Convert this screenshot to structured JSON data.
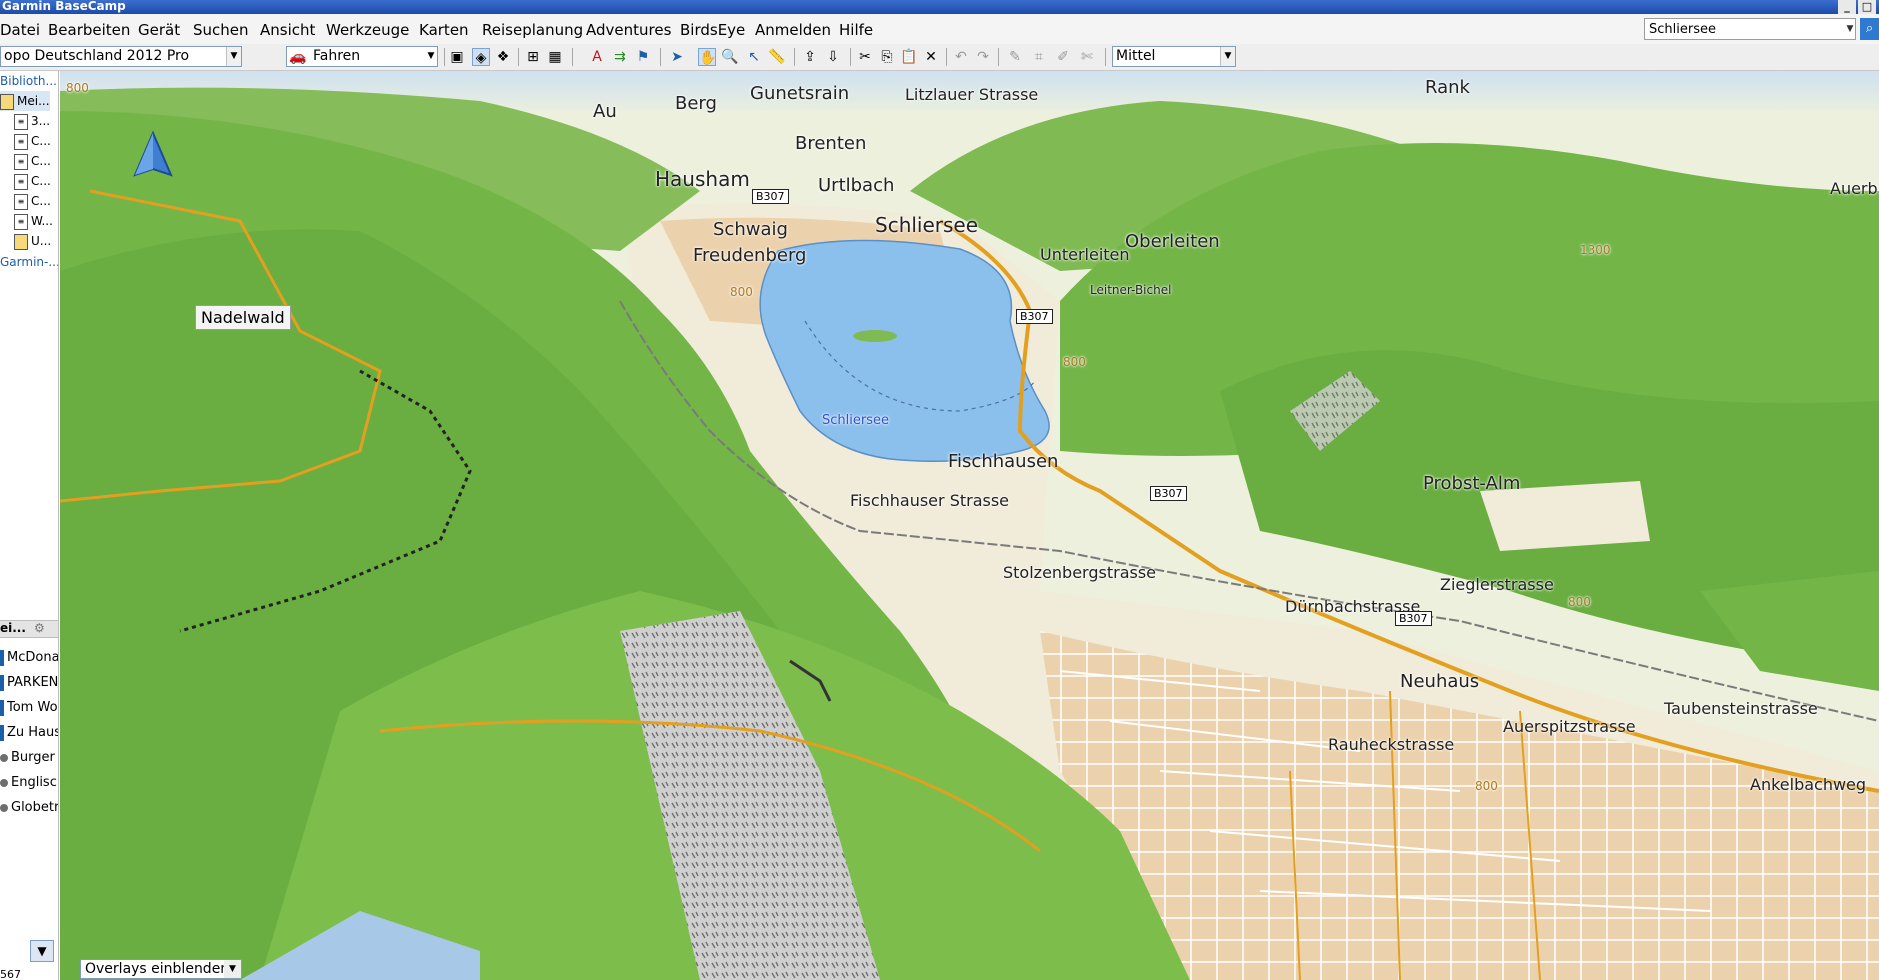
{
  "window": {
    "title": "Garmin BaseCamp"
  },
  "menu": [
    "Datei",
    "Bearbeiten",
    "Gerät",
    "Suchen",
    "Ansicht",
    "Werkzeuge",
    "Karten",
    "Reiseplanung",
    "Adventures",
    "BirdsEye",
    "Anmelden",
    "Hilfe"
  ],
  "search": {
    "value": "Schliersee"
  },
  "toolbar": {
    "map_product": "opo Deutschland 2012 Pro",
    "profile": "Fahren",
    "detail": "Mittel"
  },
  "library": {
    "header": "Biblioth...",
    "items": [
      "Mei...",
      "3...",
      "C...",
      "C...",
      "C...",
      "C...",
      "W...",
      "U...",
      "Garmin-..."
    ]
  },
  "list_panel": {
    "header": "ei...",
    "items": [
      "McDona",
      "PARKEN",
      "Tom Wo",
      "Zu Haus",
      "Burger K",
      "Englisch",
      "Globetro"
    ]
  },
  "status_fragment": "567",
  "map": {
    "places": [
      "Rank",
      "Au",
      "Berg",
      "Gunetsrain",
      "Litzlauer Strasse",
      "Brenten",
      "Hausham",
      "Urtlbach",
      "Schwaig",
      "Schliersee",
      "Freudenberg",
      "Unterleiten",
      "Oberleiten",
      "Leitner-Bichel",
      "Fischhausen",
      "Fischhauser Strasse",
      "Probst-Alm",
      "Stolzenbergstrasse",
      "Zieglerstrasse",
      "Dürnbachstrasse",
      "Neuhaus",
      "Taubensteinstrasse",
      "Auerspitzstrasse",
      "Rauheckstrasse",
      "Ankelbachweg",
      "Auerb"
    ],
    "lake_label": "Schliersee",
    "roads": [
      "B307",
      "B307",
      "B307",
      "B307"
    ],
    "contours": [
      "800",
      "800",
      "800",
      "1300",
      "800",
      "800"
    ],
    "tooltip": "Nadelwald",
    "overlays_select": "Overlays einblenden"
  },
  "colors": {
    "forest": "#74b548",
    "lake": "#8cc0ec",
    "urban": "#e9c9a0",
    "meadow": "#f1ecd9",
    "road": "#e3a020"
  },
  "icons": [
    "compass-arrow-icon",
    "pan-hand-icon",
    "zoom-icon",
    "select-arrow-icon",
    "measure-icon",
    "cut-icon",
    "copy-icon",
    "paste-icon",
    "delete-icon",
    "undo-icon",
    "redo-icon",
    "filter-icon",
    "search-go-icon"
  ]
}
